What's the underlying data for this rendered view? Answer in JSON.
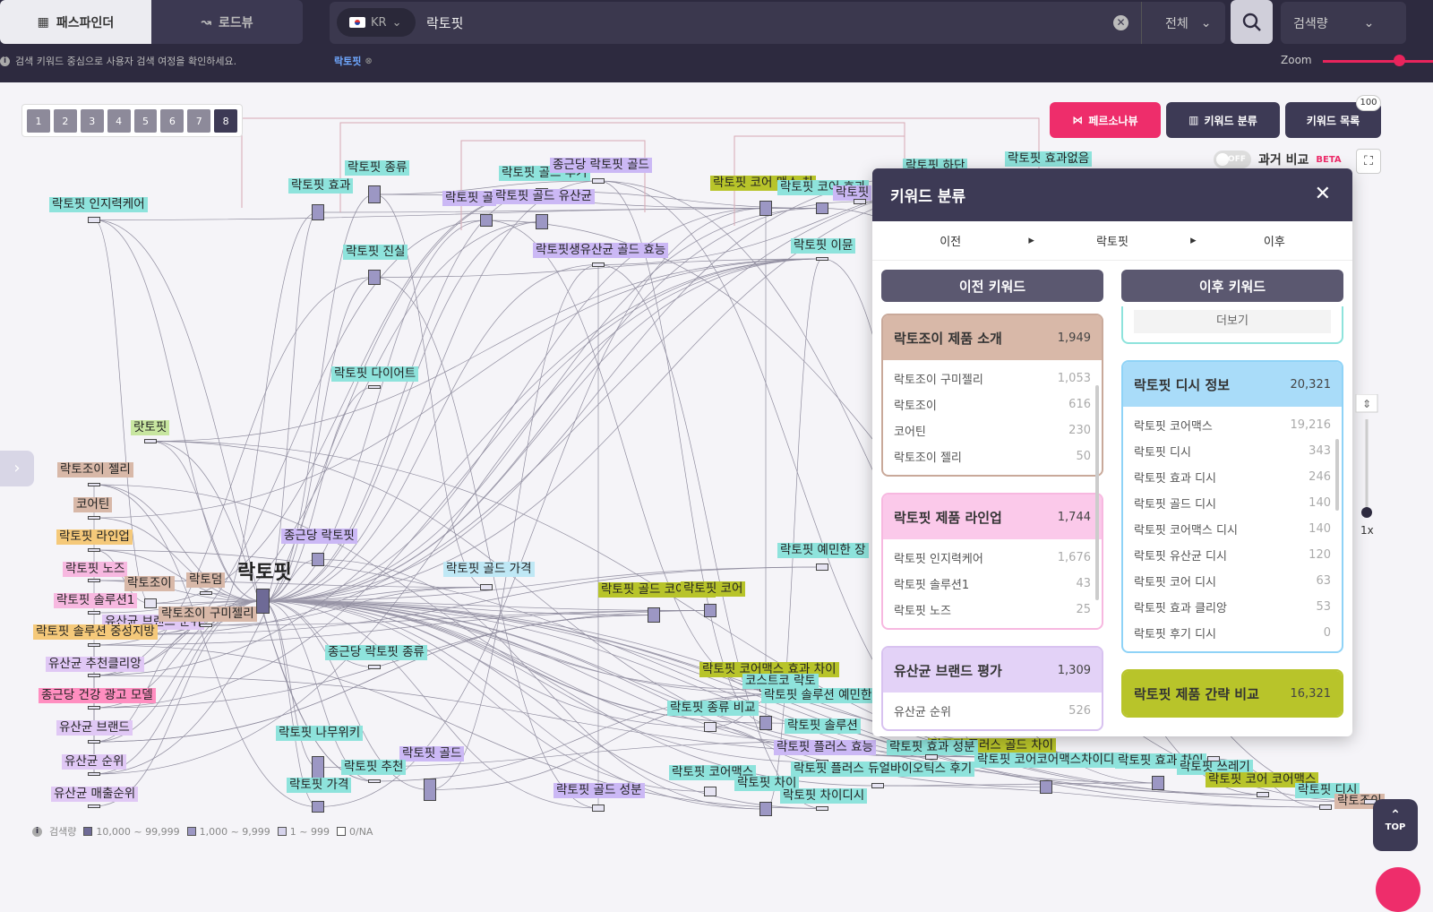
{
  "top_tabs": {
    "pathfinder": "패스파인더",
    "roadview": "로드뷰"
  },
  "search": {
    "country": "KR",
    "query": "락토핏",
    "scope": "전체",
    "sort": "검색량"
  },
  "hint": "검색 키워드 중심으로 사용자 검색 여정을 확인하세요.",
  "chip": "락토핏",
  "zoom_label": "Zoom",
  "pages": [
    "1",
    "2",
    "3",
    "4",
    "5",
    "6",
    "7",
    "8"
  ],
  "actions": {
    "persona": "페르소나뷰",
    "classify": "키워드 분류",
    "list": "키워드 목록",
    "list_badge": "100"
  },
  "compare": {
    "toggle": "OFF",
    "label": "과거 비교",
    "beta": "BETA"
  },
  "graph_center": "락토핏",
  "graph_nodes": [
    {
      "label": "락토핏 인지력케어",
      "color": "#8ee3dc"
    },
    {
      "label": "락토핏 종류",
      "color": "#8ee3dc"
    },
    {
      "label": "락토핏 효과",
      "color": "#8ee3dc"
    },
    {
      "label": "락토핏 골드 후기",
      "color": "#8ee3dc"
    },
    {
      "label": "종근당 락토핏 골드",
      "color": "#cbb8f5"
    },
    {
      "label": "락토핏 골",
      "color": "#cbb8f5"
    },
    {
      "label": "락토핏 골드 유산균",
      "color": "#cbb8f5"
    },
    {
      "label": "락토핏 진실",
      "color": "#8ee3dc"
    },
    {
      "label": "락토핏생유산균 골드 효능",
      "color": "#cbb8f5"
    },
    {
      "label": "락토핏 코어 맥스 차",
      "color": "#b8c42a"
    },
    {
      "label": "락토핏 코어 효과",
      "color": "#8ee3dc"
    },
    {
      "label": "락토핏",
      "color": "#cbb8f5"
    },
    {
      "label": "락토핏 하단",
      "color": "#8ee3dc"
    },
    {
      "label": "락토핏 효과없음",
      "color": "#8ee3dc"
    },
    {
      "label": "락토핏 이뮨",
      "color": "#8ee3dc"
    },
    {
      "label": "락토핏 다이어트",
      "color": "#8ee3dc"
    },
    {
      "label": "랏토핏",
      "color": "#c8e6a0"
    },
    {
      "label": "락토조이 젤리",
      "color": "#d8b8a8"
    },
    {
      "label": "코어틴",
      "color": "#d8b8a8"
    },
    {
      "label": "락토핏 라인업",
      "color": "#f5c97a"
    },
    {
      "label": "락토핏 노즈",
      "color": "#f7b8e0"
    },
    {
      "label": "락토조이",
      "color": "#d8b8a8"
    },
    {
      "label": "락토덤",
      "color": "#d8b8a8"
    },
    {
      "label": "락토핏 솔루션1",
      "color": "#f7b8e0"
    },
    {
      "label": "유산균 브랜드 순위",
      "color": "#e0c8f5"
    },
    {
      "label": "락토조이 구미젤리",
      "color": "#d8b8a8"
    },
    {
      "label": "락토핏 솔루션 중성지방",
      "color": "#f5c97a"
    },
    {
      "label": "유산균 추천클리앙",
      "color": "#e0c8f5"
    },
    {
      "label": "종근당 건강 광고 모델",
      "color": "#ff8ec0"
    },
    {
      "label": "유산균 브랜드",
      "color": "#e0c8f5"
    },
    {
      "label": "유산균 순위",
      "color": "#e0c8f5"
    },
    {
      "label": "유산균 매출순위",
      "color": "#e0c8f5"
    },
    {
      "label": "종근당 락토핏",
      "color": "#cbb8f5"
    },
    {
      "label": "락토핏 골드 가격",
      "color": "#bfe8f5"
    },
    {
      "label": "락토핏 골드 코어 차이",
      "color": "#b8c42a"
    },
    {
      "label": "락토핏 코어",
      "color": "#b8c42a"
    },
    {
      "label": "락토핏 예민한 장",
      "color": "#8ee3dc"
    },
    {
      "label": "종근당 락토핏 종류",
      "color": "#8ee3dc"
    },
    {
      "label": "락토핏 코어맥스 효과 차이",
      "color": "#b8c42a"
    },
    {
      "label": "코스트코 락토",
      "color": "#8ee3dc"
    },
    {
      "label": "락토핏 솔루션 예민한 장",
      "color": "#8ee3dc"
    },
    {
      "label": "락토핏 종류 비교",
      "color": "#8ee3dc"
    },
    {
      "label": "락토핏 솔루션",
      "color": "#8ee3dc"
    },
    {
      "label": "락토핏 나무위키",
      "color": "#8ee3dc"
    },
    {
      "label": "락토핏 플러스 효능",
      "color": "#cbb8f5"
    },
    {
      "label": "락토핏 골드",
      "color": "#cbb8f5"
    },
    {
      "label": "락토핏 추천",
      "color": "#8ee3dc"
    },
    {
      "label": "락토핏 가격",
      "color": "#8ee3dc"
    },
    {
      "label": "락토핏 골드 성분",
      "color": "#cbb8f5"
    },
    {
      "label": "락토핏 코어맥스",
      "color": "#8ee3dc"
    },
    {
      "label": "락토핏 차이",
      "color": "#8ee3dc"
    },
    {
      "label": "락토핏 차이디시",
      "color": "#8ee3dc"
    },
    {
      "label": "락토핏 플러스 듀얼바이오틱스 후기",
      "color": "#8ee3dc"
    },
    {
      "label": "락토핏 플러스 골드 차이",
      "color": "#b8c42a"
    },
    {
      "label": "락토핏 효과 성분",
      "color": "#8ee3dc"
    },
    {
      "label": "락토핏 코어코어맥스차이디시",
      "color": "#8ee3dc"
    },
    {
      "label": "락토핏 효과 차이",
      "color": "#8ee3dc"
    },
    {
      "label": "락토핏 쓰레기",
      "color": "#8ee3dc"
    },
    {
      "label": "락토핏 코어 코어맥스",
      "color": "#b8c42a"
    },
    {
      "label": "락토핏 디시",
      "color": "#8ee3dc"
    },
    {
      "label": "락토조이",
      "color": "#d8b8a8"
    }
  ],
  "legend": {
    "title": "검색량",
    "tiers": [
      "10,000 ~ 99,999",
      "1,000 ~ 9,999",
      "1 ~ 999",
      "0/NA"
    ]
  },
  "panel": {
    "title": "키워드 분류",
    "flow": [
      "이전",
      "락토핏",
      "이후"
    ],
    "prev_header": "이전 키워드",
    "next_header": "이후 키워드",
    "more": "더보기",
    "prev_cards": [
      {
        "title": "락토조이 제품 소개",
        "count": "1,949",
        "color": "#c9a99a",
        "bg": "#d8b8a8",
        "rows": [
          {
            "k": "락토조이 구미젤리",
            "n": "1,053"
          },
          {
            "k": "락토조이",
            "n": "616"
          },
          {
            "k": "코어틴",
            "n": "230"
          },
          {
            "k": "락토조이 젤리",
            "n": "50"
          }
        ]
      },
      {
        "title": "락토핏 제품 라인업",
        "count": "1,744",
        "color": "#f7b8e0",
        "bg": "#fbc9ea",
        "rows": [
          {
            "k": "락토핏 인지력케어",
            "n": "1,676"
          },
          {
            "k": "락토핏 솔루션1",
            "n": "43"
          },
          {
            "k": "락토핏 노즈",
            "n": "25"
          }
        ]
      },
      {
        "title": "유산균 브랜드 평가",
        "count": "1,309",
        "color": "#d8c2f0",
        "bg": "#e3d2f7",
        "rows": [
          {
            "k": "유산균 순위",
            "n": "526"
          }
        ]
      }
    ],
    "next_cards": [
      {
        "title": "락토핏 디시 정보",
        "count": "20,321",
        "color": "#8fd3f7",
        "bg": "#a9dcf9",
        "rows": [
          {
            "k": "락토핏 코어맥스",
            "n": "19,216"
          },
          {
            "k": "락토핏 디시",
            "n": "343"
          },
          {
            "k": "락토핏 효과 디시",
            "n": "246"
          },
          {
            "k": "락토핏 골드 디시",
            "n": "140"
          },
          {
            "k": "락토핏 코어맥스 디시",
            "n": "140"
          },
          {
            "k": "락토핏 유산균 디시",
            "n": "120"
          },
          {
            "k": "락토핏 코어 디시",
            "n": "63"
          },
          {
            "k": "락토핏 효과 클리앙",
            "n": "53"
          },
          {
            "k": "락토핏 후기 디시",
            "n": "0"
          }
        ]
      },
      {
        "title": "락토핏 제품 간략 비교",
        "count": "16,321",
        "color": "#b8c42a",
        "bg": "#b8c42a",
        "rows": []
      }
    ]
  },
  "zoom_ctl": "1x",
  "top_btn": "TOP"
}
